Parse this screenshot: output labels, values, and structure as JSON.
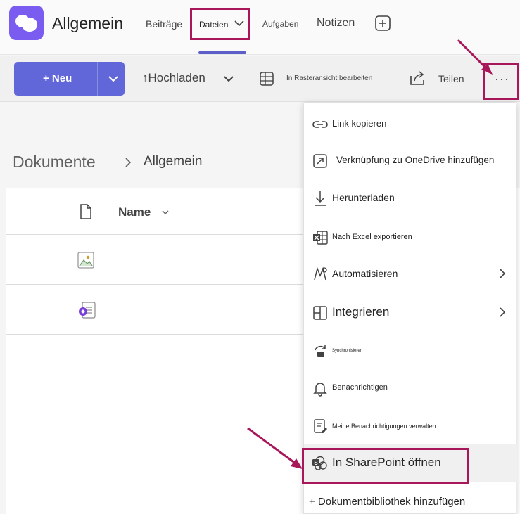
{
  "header": {
    "channel_title": "Allgemein",
    "tabs": [
      {
        "label": "Beiträge"
      },
      {
        "label": "Dateien"
      },
      {
        "label": "Aufgaben"
      },
      {
        "label": "Notizen"
      }
    ],
    "active_tab": "Dateien"
  },
  "toolbar": {
    "new_label": "+ Neu",
    "upload_label": "Hochladen",
    "grid_edit_label": "In Rasteransicht bearbeiten",
    "share_label": "Teilen",
    "more_label": "···"
  },
  "breadcrumb": {
    "root": "Dokumente",
    "leaf": "Allgemein"
  },
  "file_list": {
    "name_column": "Name"
  },
  "menu": {
    "items": [
      {
        "label": "Link kopieren",
        "icon": "link-icon"
      },
      {
        "label": "Verknüpfung zu OneDrive hinzufügen",
        "icon": "shortcut-arrow-icon"
      },
      {
        "label": "Herunterladen",
        "icon": "download-icon"
      },
      {
        "label": "Nach Excel exportieren",
        "icon": "excel-icon"
      },
      {
        "label": "Automatisieren",
        "icon": "flow-icon"
      },
      {
        "label": "Integrieren",
        "icon": "apps-icon"
      },
      {
        "label": "Synchronisieren",
        "icon": "sync-icon"
      },
      {
        "label": "Benachrichtigen",
        "icon": "bell-icon"
      },
      {
        "label": "Meine Benachrichtigungen verwalten",
        "icon": "alert-settings-icon"
      },
      {
        "label": "In SharePoint öffnen",
        "icon": "sharepoint-icon"
      },
      {
        "label": "+ Dokumentbibliothek hinzufügen",
        "icon": ""
      }
    ]
  },
  "colors": {
    "accent": "#5b5fc7",
    "new_button": "#6167d8",
    "highlight": "#a8175a",
    "logo": "#7b5cf0"
  }
}
